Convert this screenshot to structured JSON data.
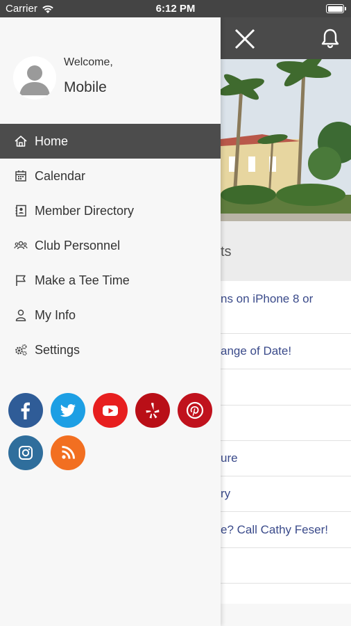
{
  "status_bar": {
    "carrier": "Carrier",
    "time": "6:12 PM"
  },
  "drawer": {
    "welcome_text": "Welcome,",
    "user_name": "Mobile",
    "menu": [
      {
        "label": "Home",
        "icon": "home-icon",
        "active": true
      },
      {
        "label": "Calendar",
        "icon": "calendar-icon"
      },
      {
        "label": "Member Directory",
        "icon": "contact-book-icon"
      },
      {
        "label": "Club Personnel",
        "icon": "group-icon"
      },
      {
        "label": "Make a Tee Time",
        "icon": "flag-icon"
      },
      {
        "label": "My Info",
        "icon": "person-icon"
      },
      {
        "label": "Settings",
        "icon": "gears-icon"
      }
    ],
    "social": [
      {
        "name": "facebook",
        "color": "#2f5c97"
      },
      {
        "name": "twitter",
        "color": "#1d9fe4"
      },
      {
        "name": "youtube",
        "color": "#e71f1f"
      },
      {
        "name": "yelp",
        "color": "#b90f17"
      },
      {
        "name": "pinterest",
        "color": "#c0121d"
      },
      {
        "name": "instagram",
        "color": "#2f6e9c"
      },
      {
        "name": "rss",
        "color": "#f26f21"
      }
    ]
  },
  "background_app": {
    "section_title": "ts",
    "news": [
      "ns on iPhone 8 or",
      "ange of Date!",
      "",
      "",
      "ure",
      "ry",
      "e? Call Cathy Feser!",
      "",
      ""
    ]
  },
  "colors": {
    "header": "#4a4a4a",
    "drawer_bg": "#f7f7f7",
    "active_item": "#4c4c4c",
    "link_text": "#3a4a8a"
  }
}
